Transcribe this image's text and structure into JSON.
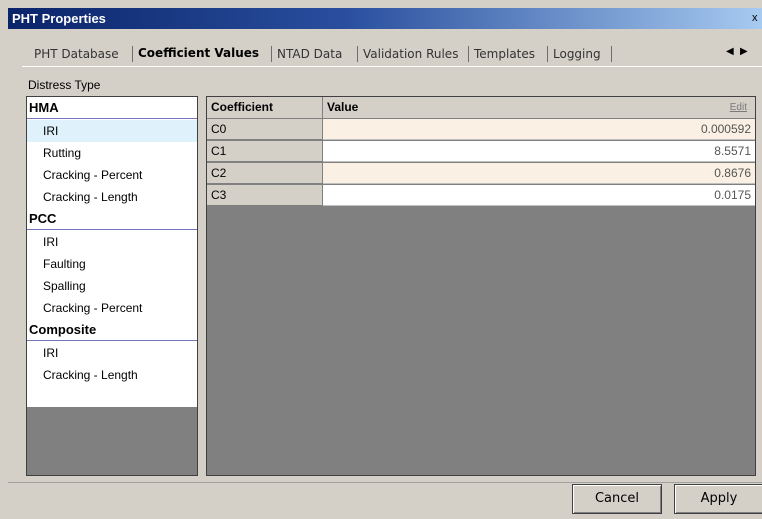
{
  "window": {
    "title": "PHT Properties",
    "close_glyph": "x"
  },
  "tabs": [
    {
      "label": "PHT Database",
      "active": false
    },
    {
      "label": "Coefficient Values",
      "active": true
    },
    {
      "label": "NTAD Data",
      "active": false
    },
    {
      "label": "Validation Rules",
      "active": false
    },
    {
      "label": "Templates",
      "active": false
    },
    {
      "label": "Logging",
      "active": false
    }
  ],
  "tab_scroll": {
    "left": "◀",
    "right": "▶"
  },
  "distress": {
    "label": "Distress Type",
    "groups": [
      {
        "name": "HMA",
        "items": [
          "IRI",
          "Rutting",
          "Cracking - Percent",
          "Cracking - Length"
        ]
      },
      {
        "name": "PCC",
        "items": [
          "IRI",
          "Faulting",
          "Spalling",
          "Cracking - Percent"
        ]
      },
      {
        "name": "Composite",
        "items": [
          "IRI",
          "Cracking - Length"
        ]
      }
    ],
    "selected": "HMA / IRI"
  },
  "grid": {
    "headers": {
      "coefficient": "Coefficient",
      "value": "Value",
      "edit": "Edit"
    },
    "rows": [
      {
        "coefficient": "C0",
        "value": "0.000592"
      },
      {
        "coefficient": "C1",
        "value": "8.5571"
      },
      {
        "coefficient": "C2",
        "value": "0.8676"
      },
      {
        "coefficient": "C3",
        "value": "0.0175"
      }
    ]
  },
  "buttons": {
    "cancel": "Cancel",
    "apply": "Apply"
  },
  "colors": {
    "titlebar": "#0a246a",
    "selected_row": "#dff1fb",
    "alt_row": "#faf0e4",
    "grid_bg": "#808080"
  }
}
